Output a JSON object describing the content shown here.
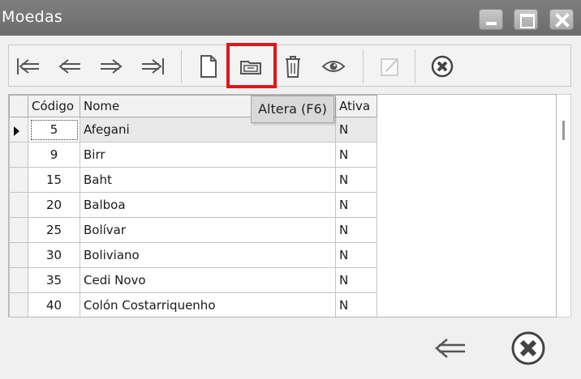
{
  "window": {
    "title": "Moedas",
    "controls": [
      "minimize-icon",
      "maximize-icon",
      "close-icon"
    ]
  },
  "toolbar": {
    "buttons": [
      {
        "name": "first-record-icon",
        "enabled": true
      },
      {
        "name": "previous-record-icon",
        "enabled": true
      },
      {
        "name": "next-record-icon",
        "enabled": true
      },
      {
        "name": "last-record-icon",
        "enabled": true
      },
      {
        "name": "new-document-icon",
        "enabled": true
      },
      {
        "name": "edit-folder-icon",
        "enabled": true,
        "highlighted": true
      },
      {
        "name": "trash-icon",
        "enabled": true
      },
      {
        "name": "eye-icon",
        "enabled": true
      },
      {
        "name": "edit-disabled-icon",
        "enabled": false
      },
      {
        "name": "cancel-circle-icon",
        "enabled": true
      }
    ],
    "highlight_color": "#e0161d"
  },
  "tooltip": {
    "text": "Altera (F6)"
  },
  "table": {
    "columns": [
      "Código",
      "Nome",
      "Ativa"
    ],
    "rows": [
      {
        "codigo": "5",
        "nome": "Afegani",
        "ativa": "N",
        "selected": true
      },
      {
        "codigo": "9",
        "nome": "Birr",
        "ativa": "N"
      },
      {
        "codigo": "15",
        "nome": "Baht",
        "ativa": "N"
      },
      {
        "codigo": "20",
        "nome": "Balboa",
        "ativa": "N"
      },
      {
        "codigo": "25",
        "nome": "Bolívar",
        "ativa": "N"
      },
      {
        "codigo": "30",
        "nome": "Boliviano",
        "ativa": "N"
      },
      {
        "codigo": "35",
        "nome": "Cedi Novo",
        "ativa": "N"
      },
      {
        "codigo": "40",
        "nome": "Colón Costarriquenho",
        "ativa": "N"
      }
    ]
  },
  "footer": {
    "buttons": [
      "back-arrow-icon",
      "cancel-circle-icon"
    ]
  }
}
